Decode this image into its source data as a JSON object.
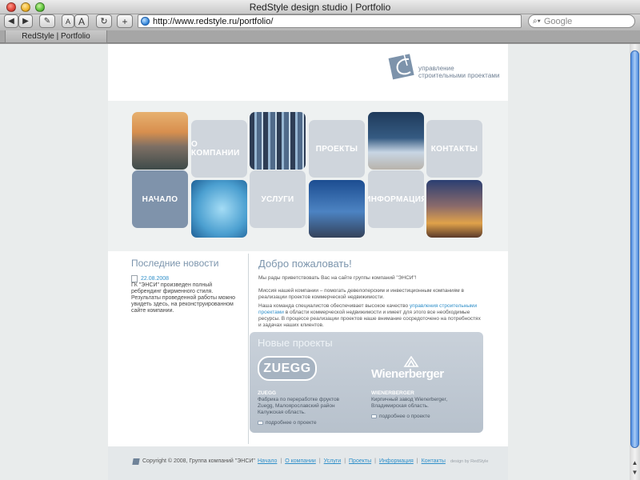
{
  "window": {
    "title": "RedStyle design studio | Portfolio",
    "tab": "RedStyle | Portfolio"
  },
  "toolbar": {
    "back_label": "◀",
    "forward_label": "▶",
    "edit_label": "✎",
    "font_small_label": "A",
    "font_big_label": "A",
    "reload_label": "↻",
    "add_label": "+",
    "url": "http://www.redstyle.ru/portfolio/",
    "search_placeholder": "Google"
  },
  "site": {
    "logo_line1": "управление",
    "logo_line2": "строительными проектами",
    "nav": {
      "about": "О КОМПАНИИ",
      "projects": "ПРОЕКТЫ",
      "contacts": "КОНТАКТЫ",
      "home": "НАЧАЛО",
      "services": "УСЛУГИ",
      "info": "ИНФОРМАЦИЯ"
    },
    "news": {
      "title": "Последние новости",
      "date": "22.08.2008",
      "text": "ГК \"ЭНСИ\" произведен полный ребрендинг фирменного стиля. Результаты проведенной работы можно увидеть здесь, на реконструированном сайте компании."
    },
    "welcome": {
      "title": "Добро пожаловать!",
      "p1": "Мы рады приветствовать Вас на сайте группы компаний \"ЭНСИ\"!",
      "p2": "Миссия нашей компании – помогать девелоперским и инвестиционным компаниям в реализации проектов коммерческой недвижимости.",
      "p3_before": "Наша команда специалистов обеспечивает высокое качество ",
      "p3_link": "управления строительными проектами",
      "p3_after": " в области коммерческой недвижимости и имеет для этого все необходимые ресурсы. В процессе реализации проектов наше внимание сосредоточено на потребностях и задачах наших клиентов."
    },
    "new_projects": {
      "title": "Новые проекты",
      "items": [
        {
          "logo": "ZUEGG",
          "name": "ZUEGG",
          "desc1": "Фабрика по переработке фруктов",
          "desc2": "Zuegg, Малоярославский район",
          "desc3": "Калужская область.",
          "link": "подробнее о проекте"
        },
        {
          "logo": "Wienerberger",
          "name": "WIENERBERGER",
          "desc1": "Кирпичный завод Wienerberger,",
          "desc2": "Владимирская область.",
          "link": "подробнее о проекте"
        }
      ]
    },
    "footer": {
      "copyright": "Copyright © 2008, Группа компаний \"ЭНСИ\"",
      "links": [
        "Начало",
        "О компании",
        "Услуги",
        "Проекты",
        "Информация",
        "Контакты"
      ],
      "design_by": "design by RedStyle"
    }
  },
  "colors": {
    "nav_tile": "#cfd5dc",
    "nav_tile_active": "#7f93ab",
    "link": "#2f8fc9",
    "heading": "#7c95ad",
    "scroll_thumb": "#4e8ce0"
  }
}
